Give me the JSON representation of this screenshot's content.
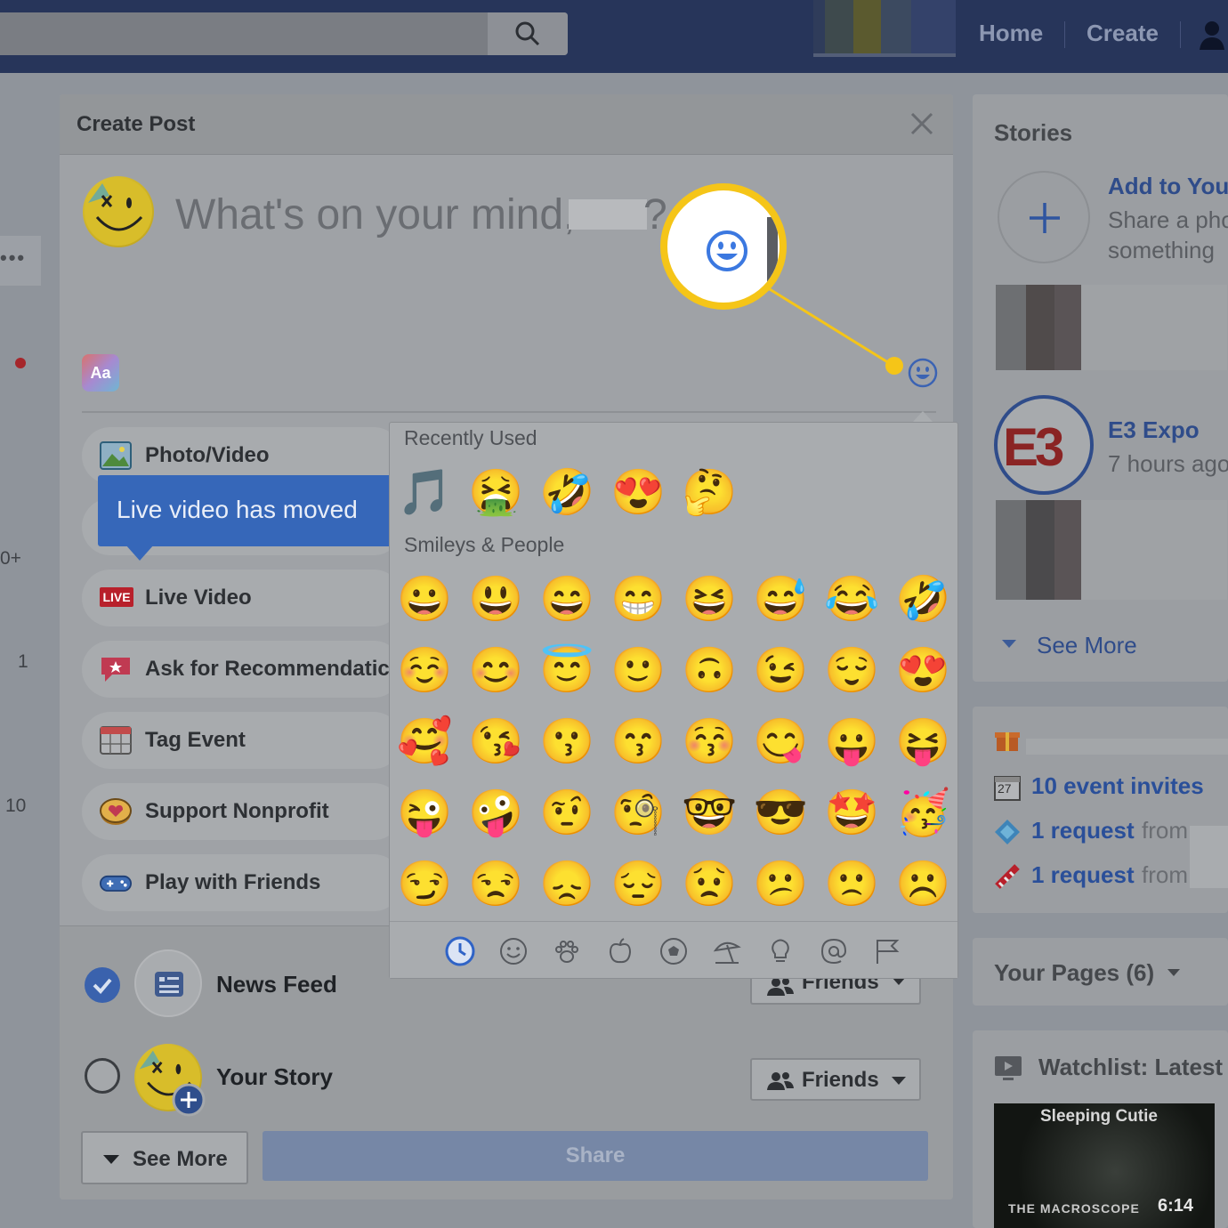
{
  "topbar": {
    "nav_home": "Home",
    "nav_create": "Create"
  },
  "left_strip": {
    "dots": "•••",
    "num_1": "0+",
    "num_2": "1",
    "num_3": "10"
  },
  "modal": {
    "title": "Create Post",
    "prompt": "What's your mind,",
    "prompt_full": "What's on your mind,",
    "prompt_end": "?",
    "aa_label": "Aa",
    "actions": [
      {
        "label": "Photo/Video",
        "icon": "photo-icon"
      },
      {
        "label": "Live Video",
        "icon": "live-icon"
      },
      {
        "label": "Ask for Recommendatic",
        "icon": "recommendation-icon"
      },
      {
        "label": "Tag Event",
        "icon": "calendar-icon"
      },
      {
        "label": "Support Nonprofit",
        "icon": "heart-coin-icon"
      },
      {
        "label": "Play with Friends",
        "icon": "gamepad-icon"
      }
    ],
    "live_badge": "LIVE",
    "tooltip": "Live video has moved",
    "audience": {
      "news_feed": "News Feed",
      "your_story": "Your Story",
      "friends_1": "Friends",
      "friends_2": "Friends"
    },
    "see_more": "See More",
    "share": "Share"
  },
  "emoji_picker": {
    "recently_used_label": "Recently Used",
    "smileys_label": "Smileys & People",
    "recently_used": [
      "🎵",
      "🤮",
      "🤣",
      "😍",
      "🤔"
    ],
    "smileys": [
      [
        "😀",
        "😃",
        "😄",
        "😁",
        "😆",
        "😅",
        "😂",
        "🤣"
      ],
      [
        "☺️",
        "😊",
        "😇",
        "🙂",
        "🙃",
        "😉",
        "😌",
        "😍"
      ],
      [
        "🥰",
        "😘",
        "😗",
        "😙",
        "😚",
        "😋",
        "😛",
        "😝"
      ],
      [
        "😜",
        "🤪",
        "🤨",
        "🧐",
        "🤓",
        "😎",
        "🤩",
        "🥳"
      ],
      [
        "😏",
        "😒",
        "😞",
        "😔",
        "😟",
        "😕",
        "🙁",
        "☹️"
      ]
    ],
    "tabs": [
      "clock-icon",
      "smiley-icon",
      "paw-icon",
      "apple-icon",
      "ball-icon",
      "umbrella-icon",
      "bulb-icon",
      "at-icon",
      "flag-icon"
    ],
    "active_tab": "clock-icon"
  },
  "right_column": {
    "stories_title": "Stories",
    "add_story_title": "Add to You",
    "add_story_sub_1": "Share a pho",
    "add_story_sub_2": "something",
    "e3_title": "E3 Expo",
    "e3_time": "7 hours ago",
    "e3_logo": "E3",
    "see_more": "See More",
    "event_day": "27",
    "event_invites": "10 event invites",
    "request_1": "1 request",
    "request_1_from": "from",
    "request_2": "1 request",
    "request_2_from": "from",
    "your_pages": "Your Pages (6)",
    "watchlist": "Watchlist: Latest",
    "video_title": "Sleeping Cutie",
    "video_brand": "THE MACROSCOPE",
    "video_time": "6:14"
  },
  "colors": {
    "accent_blue": "#3a62ad",
    "highlight_yellow": "#f5c518"
  }
}
